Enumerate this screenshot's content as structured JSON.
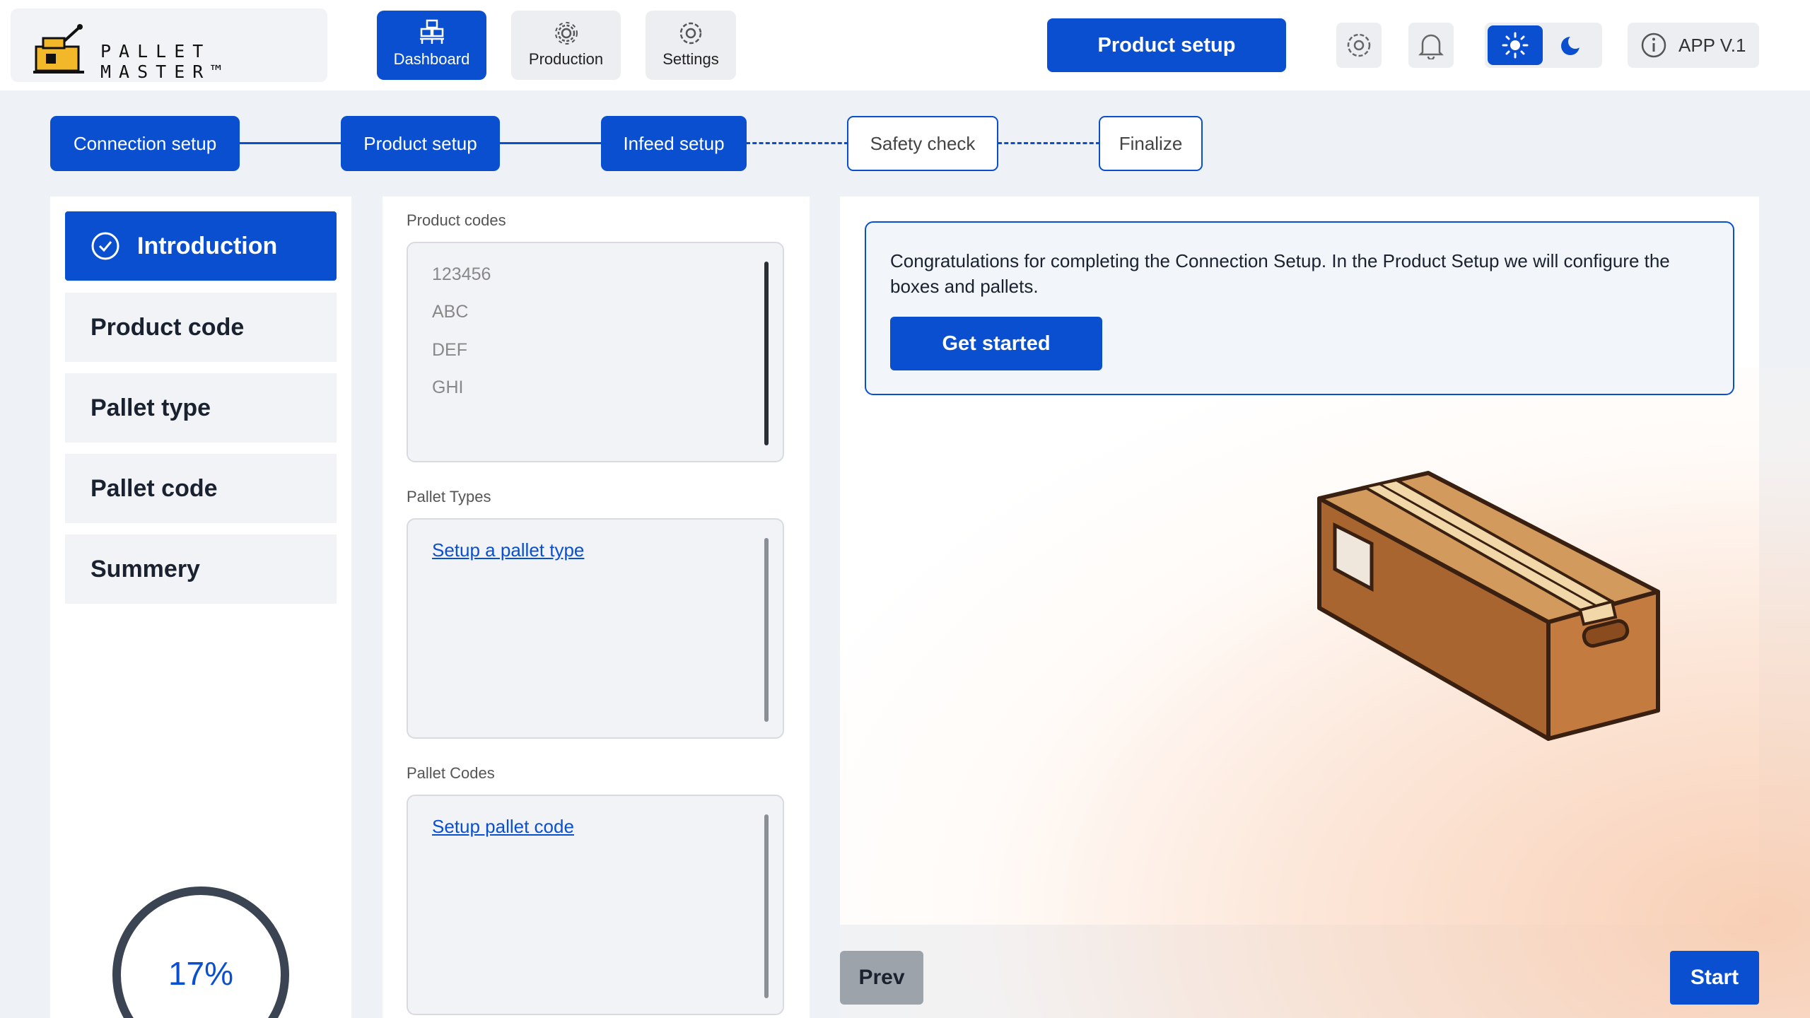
{
  "app": {
    "logo_text": "PALLET MASTER™",
    "version_label": "APP V.1",
    "primary_action": "Product setup"
  },
  "nav": {
    "items": [
      {
        "label": "Dashboard",
        "icon": "pallet-icon",
        "active": true
      },
      {
        "label": "Production",
        "icon": "gear-icon",
        "active": false
      },
      {
        "label": "Settings",
        "icon": "settings-icon",
        "active": false
      }
    ]
  },
  "header_icons": [
    "settings-icon",
    "bell-icon",
    "sun-icon",
    "moon-icon",
    "info-icon"
  ],
  "stepper": {
    "steps": [
      {
        "label": "Connection setup",
        "done": true
      },
      {
        "label": "Product setup",
        "done": true
      },
      {
        "label": "Infeed setup",
        "done": true
      },
      {
        "label": "Safety check",
        "done": false
      },
      {
        "label": "Finalize",
        "done": false
      }
    ]
  },
  "sidebar": {
    "items": [
      {
        "label": "Introduction",
        "active": true
      },
      {
        "label": "Product code",
        "active": false
      },
      {
        "label": "Pallet type",
        "active": false
      },
      {
        "label": "Pallet code",
        "active": false
      },
      {
        "label": "Summery",
        "active": false
      }
    ],
    "progress": {
      "percent": 17,
      "label": "17%"
    }
  },
  "lists": {
    "product_codes": {
      "label": "Product codes",
      "items": [
        "123456",
        "ABC",
        "DEF",
        "GHI"
      ]
    },
    "pallet_types": {
      "label": "Pallet Types",
      "link": "Setup a pallet type"
    },
    "pallet_codes": {
      "label": "Pallet Codes",
      "link": "Setup pallet code"
    }
  },
  "intro": {
    "message": "Congratulations for completing the Connection Setup. In the Product Setup we will configure the boxes and pallets.",
    "button": "Get started"
  },
  "footer": {
    "prev": "Prev",
    "start": "Start"
  },
  "colors": {
    "accent": "#0a4fd0",
    "background": "#eef2f7",
    "box_brown": "#b9713a",
    "glow": "#f8cdb2"
  }
}
